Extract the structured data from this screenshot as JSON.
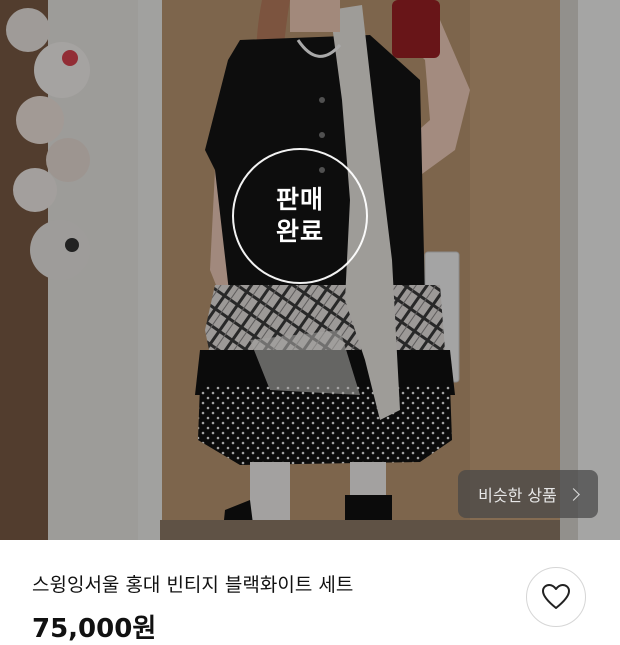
{
  "overlay": {
    "sold_label": "판매 완료"
  },
  "similar_button": {
    "label": "비슷한 상품",
    "icon": "chevron-right-icon"
  },
  "product": {
    "title": "스윙잉서울 홍대 빈티지 블랙화이트 세트",
    "price": "75,000원"
  },
  "like_button": {
    "icon": "heart-outline-icon"
  },
  "colors": {
    "text": "#111111",
    "overlay_button": "#464646"
  }
}
